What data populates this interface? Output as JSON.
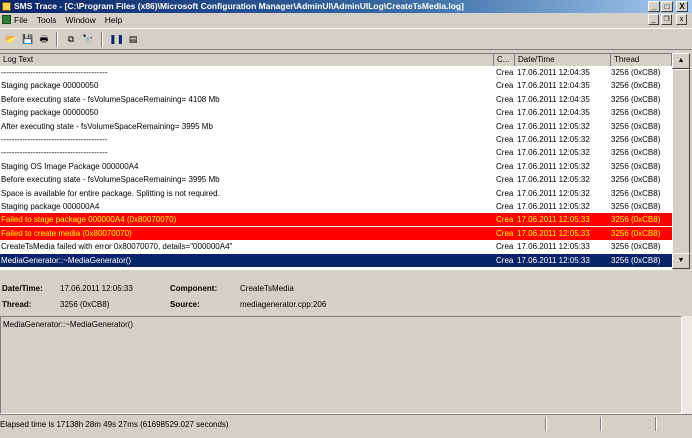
{
  "window": {
    "title": "SMS Trace - [C:\\Program Files (x86)\\Microsoft Configuration Manager\\AdminUI\\AdminUILog\\CreateTsMedia.log]",
    "minimize": "_",
    "maximize": "□",
    "close": "X",
    "mdi_minimize": "_",
    "mdi_restore": "❐",
    "mdi_close": "x"
  },
  "menu": [
    "File",
    "Tools",
    "Window",
    "Help"
  ],
  "toolbar": {
    "buttons": [
      {
        "name": "open-icon",
        "glyph": "📂"
      },
      {
        "name": "save-icon",
        "glyph": "💾"
      },
      {
        "name": "print-icon",
        "glyph": "🖶"
      },
      {
        "name": "copy-icon",
        "glyph": "⧉"
      },
      {
        "name": "find-icon",
        "glyph": "🔭"
      },
      {
        "name": "pause-icon",
        "glyph": "❚❚"
      },
      {
        "name": "properties-icon",
        "glyph": "▤"
      }
    ]
  },
  "grid": {
    "headers": [
      "Log Text",
      "C...",
      "Date/Time",
      "Thread"
    ],
    "rows": [
      {
        "text": "----------------------------------------",
        "comp": "Crea",
        "date": "17.06.2011 12:04:35",
        "thread": "3256 (0xCB8)",
        "style": "normal"
      },
      {
        "text": "Staging package 00000050",
        "comp": "Crea",
        "date": "17.06.2011 12:04:35",
        "thread": "3256 (0xCB8)",
        "style": "normal"
      },
      {
        "text": "Before executing state - fsVolumeSpaceRemaining= 4108 Mb",
        "comp": "Crea",
        "date": "17.06.2011 12:04:35",
        "thread": "3256 (0xCB8)",
        "style": "normal"
      },
      {
        "text": "Staging package 00000050",
        "comp": "Crea",
        "date": "17.06.2011 12:04:35",
        "thread": "3256 (0xCB8)",
        "style": "normal"
      },
      {
        "text": "After executing state - fsVolumeSpaceRemaining= 3995 Mb",
        "comp": "Crea",
        "date": "17.06.2011 12:05:32",
        "thread": "3256 (0xCB8)",
        "style": "normal"
      },
      {
        "text": "----------------------------------------",
        "comp": "Crea",
        "date": "17.06.2011 12:05:32",
        "thread": "3256 (0xCB8)",
        "style": "normal"
      },
      {
        "text": "----------------------------------------",
        "comp": "Crea",
        "date": "17.06.2011 12:05:32",
        "thread": "3256 (0xCB8)",
        "style": "normal"
      },
      {
        "text": "Staging OS Image Package 000000A4",
        "comp": "Crea",
        "date": "17.06.2011 12:05:32",
        "thread": "3256 (0xCB8)",
        "style": "normal"
      },
      {
        "text": "Before executing state - fsVolumeSpaceRemaining= 3995 Mb",
        "comp": "Crea",
        "date": "17.06.2011 12:05:32",
        "thread": "3256 (0xCB8)",
        "style": "normal"
      },
      {
        "text": "Space is available for entire package. Splitting is not required.",
        "comp": "Crea",
        "date": "17.06.2011 12:05:32",
        "thread": "3256 (0xCB8)",
        "style": "normal"
      },
      {
        "text": "Staging package 000000A4",
        "comp": "Crea",
        "date": "17.06.2011 12:05:32",
        "thread": "3256 (0xCB8)",
        "style": "normal"
      },
      {
        "text": "Failed to stage package 000000A4 (0x80070070)",
        "comp": "Crea",
        "date": "17.06.2011 12:05:33",
        "thread": "3256 (0xCB8)",
        "style": "error"
      },
      {
        "text": "Failed to create media (0x80070070)",
        "comp": "Crea",
        "date": "17.06.2011 12:05:33",
        "thread": "3256 (0xCB8)",
        "style": "error"
      },
      {
        "text": "CreateTsMedia failed with error 0x80070070, details=\"000000A4\"",
        "comp": "Crea",
        "date": "17.06.2011 12:05:33",
        "thread": "3256 (0xCB8)",
        "style": "normal"
      },
      {
        "text": "MediaGenerator::~MediaGenerator()",
        "comp": "Crea",
        "date": "17.06.2011 12:05:33",
        "thread": "3256 (0xCB8)",
        "style": "selected"
      }
    ]
  },
  "details": {
    "datetime_label": "Date/Time:",
    "datetime_value": "17.06.2011 12:05:33",
    "component_label": "Component:",
    "component_value": "CreateTsMedia",
    "thread_label": "Thread:",
    "thread_value": "3256 (0xCB8)",
    "source_label": "Source:",
    "source_value": "mediagenerator.cpp:206"
  },
  "message": "MediaGenerator::~MediaGenerator()",
  "status": "Elapsed time is 17138h 28m 49s 27ms (61698529.027 seconds)"
}
